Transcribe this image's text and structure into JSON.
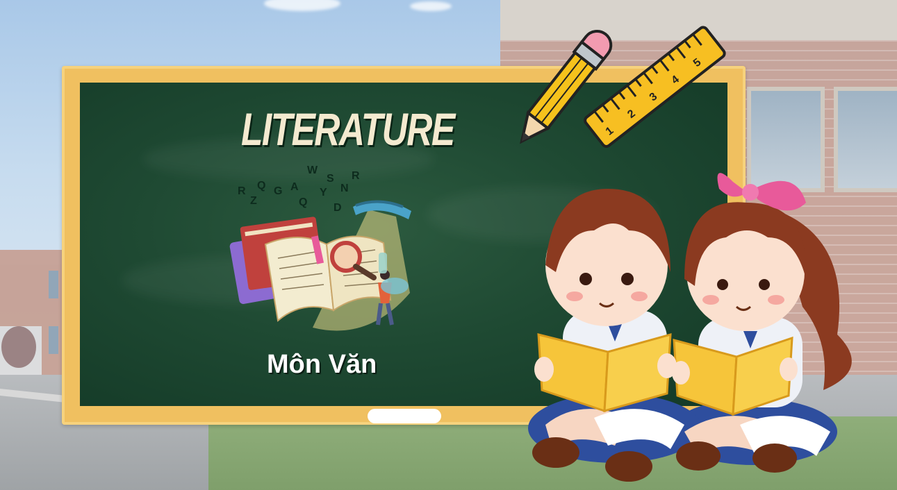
{
  "slide": {
    "title": "LITERATURE",
    "subtitle": "Môn Văn"
  },
  "illustration_icons": [
    "books-magnifier-icon",
    "pencil-icon",
    "ruler-icon",
    "kids-reading-icon"
  ],
  "colors": {
    "chalkboard": "#1f4a33",
    "frame": "#f0c060",
    "title_text": "#f4ead0",
    "subtitle_text": "#ffffff"
  }
}
